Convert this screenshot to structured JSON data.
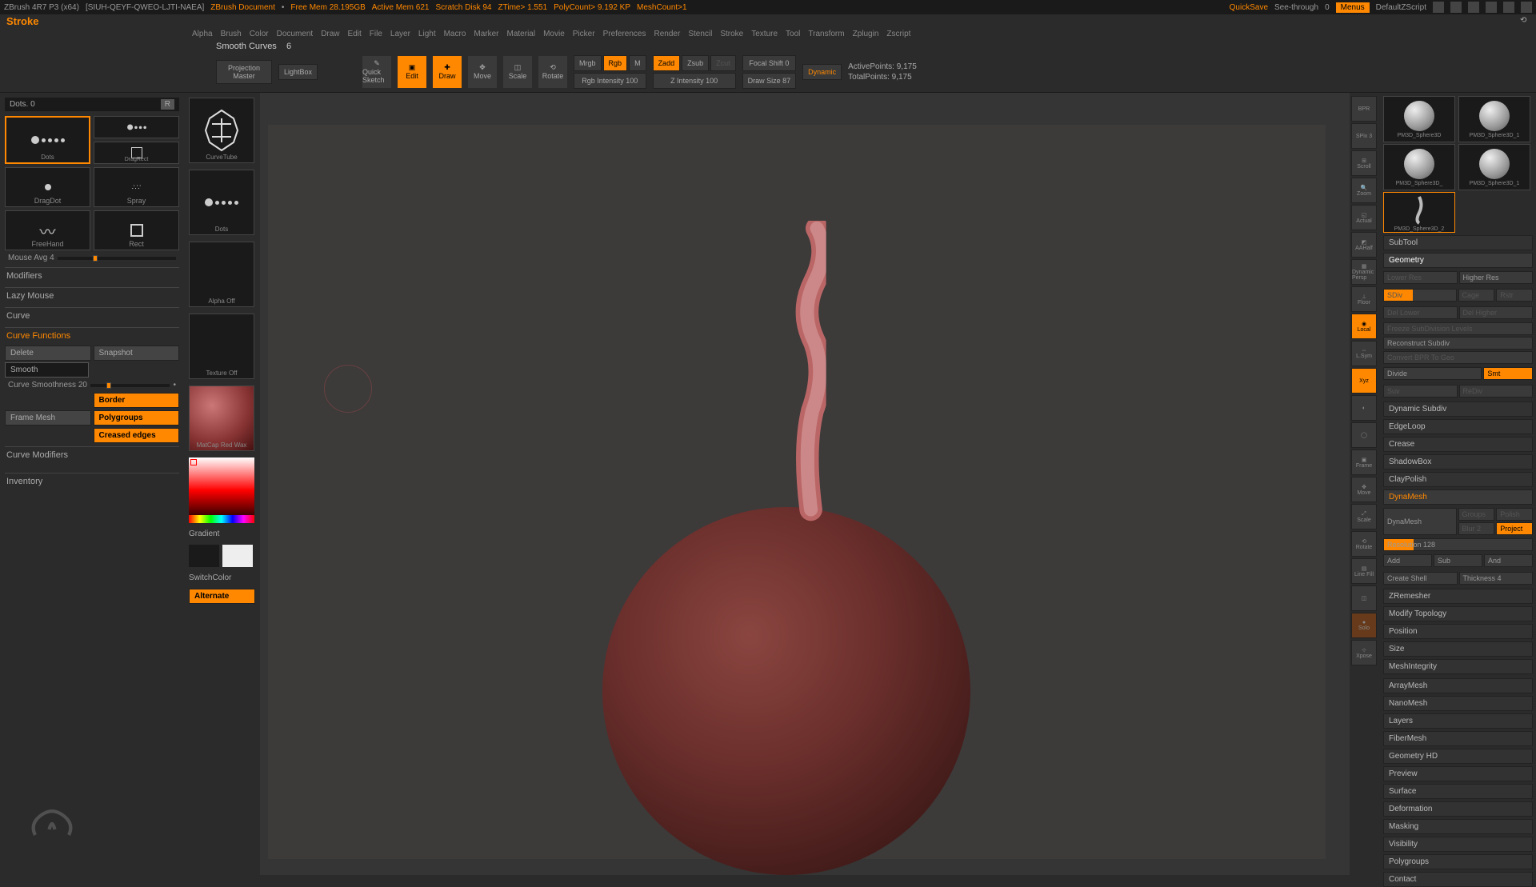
{
  "topbar": {
    "app": "ZBrush 4R7 P3 (x64)",
    "hash": "[SIUH-QEYF-QWEO-LJTI-NAEA]",
    "doc": "ZBrush Document",
    "freemem": "Free Mem 28.195GB",
    "activemem": "Active Mem 621",
    "scratch": "Scratch Disk 94",
    "ztime": "ZTime> 1.551",
    "polycount": "PolyCount> 9.192 KP",
    "meshcount": "MeshCount>1",
    "quicksave": "QuickSave",
    "seethrough": "See-through",
    "seethrough_val": "0",
    "menus": "Menus",
    "script": "DefaultZScript"
  },
  "palette_title": "Stroke",
  "menus": [
    "Alpha",
    "Brush",
    "Color",
    "Document",
    "Draw",
    "Edit",
    "File",
    "Layer",
    "Light",
    "Macro",
    "Marker",
    "Material",
    "Movie",
    "Picker",
    "Preferences",
    "Render",
    "Stencil",
    "Stroke",
    "Texture",
    "Tool",
    "Transform",
    "Zplugin",
    "Zscript"
  ],
  "status_line": {
    "text": "Smooth Curves",
    "val": "6"
  },
  "toolbar": {
    "proj_master": "Projection Master",
    "lightbox": "LightBox",
    "quick_sketch": "Quick Sketch",
    "edit": "Edit",
    "draw": "Draw",
    "move": "Move",
    "scale": "Scale",
    "rotate": "Rotate",
    "mrgb": "Mrgb",
    "rgb": "Rgb",
    "m": "M",
    "rgb_int": "Rgb Intensity 100",
    "zadd": "Zadd",
    "zsub": "Zsub",
    "zcut": "Zcut",
    "z_int": "Z Intensity 100",
    "focal": "Focal Shift 0",
    "draw_size": "Draw Size 87",
    "dynamic": "Dynamic",
    "active_pts": "ActivePoints: 9,175",
    "total_pts": "TotalPoints: 9,175"
  },
  "left": {
    "dots_label": "Dots. 0",
    "r": "R",
    "strokes": [
      "Dots",
      "Dots",
      "DragDot",
      "Spray",
      "FreeHand",
      "Rect",
      "DragRect"
    ],
    "mouse_avg": "Mouse Avg 4",
    "modifiers": "Modifiers",
    "lazy": "Lazy Mouse",
    "curve": "Curve",
    "curve_fn": "Curve Functions",
    "delete": "Delete",
    "snapshot": "Snapshot",
    "smooth": "Smooth",
    "curve_smooth": "Curve Smoothness 20",
    "border": "Border",
    "frame_mesh": "Frame Mesh",
    "polygroups": "Polygroups",
    "creased": "Creased edges",
    "curve_mod": "Curve Modifiers",
    "inventory": "Inventory"
  },
  "shelf": {
    "curve_tube": "CurveTube",
    "dots": "Dots",
    "alpha_off": "Alpha Off",
    "texture_off": "Texture Off",
    "matcap": "MatCap Red Wax",
    "gradient": "Gradient",
    "switch": "SwitchColor",
    "alternate": "Alternate"
  },
  "right_icons": [
    "BPR",
    "SPix 3",
    "Scroll",
    "Zoom",
    "Actual",
    "AAHalf",
    "Dynamic Persp",
    "Floor",
    "Local",
    "L.Sym",
    "Xyz",
    "",
    "",
    "Frame",
    "Move",
    "Scale",
    "Rotate",
    "Line Fill",
    "",
    "Solo",
    "Xpose"
  ],
  "rp": {
    "tools": [
      "PM3D_Sphere3D",
      "PM3D_Sphere3D_1",
      "PM3D_Sphere3D_",
      "PM3D_Sphere3D_1",
      "PM3D_Sphere3D_2"
    ],
    "subtool": "SubTool",
    "geometry": "Geometry",
    "lower": "Lower Res",
    "higher": "Higher Res",
    "sdiv": "SDiv",
    "cage": "Cage",
    "rstr": "Rstr",
    "del_lower": "Del Lower",
    "del_higher": "Del Higher",
    "freeze": "Freeze SubDivision Levels",
    "reconstruct": "Reconstruct Subdiv",
    "convert": "Convert BPR To Geo",
    "divide": "Divide",
    "smt": "Smt",
    "suv": "Suv",
    "rediv": "ReDiv",
    "dyn_subdiv": "Dynamic Subdiv",
    "edgeloop": "EdgeLoop",
    "crease": "Crease",
    "shadowbox": "ShadowBox",
    "claypolish": "ClayPolish",
    "dynamesh_hdr": "DynaMesh",
    "dynamesh": "DynaMesh",
    "groups": "Groups",
    "polish": "Polish",
    "blur": "Blur 2",
    "project": "Project",
    "resolution": "Resolution 128",
    "add": "Add",
    "sub": "Sub",
    "and": "And",
    "create_shell": "Create Shell",
    "thickness": "Thickness 4",
    "zremesher": "ZRemesher",
    "mod_topo": "Modify Topology",
    "position": "Position",
    "size": "Size",
    "mesh_int": "MeshIntegrity",
    "rest": [
      "ArrayMesh",
      "NanoMesh",
      "Layers",
      "FiberMesh",
      "Geometry HD",
      "Preview",
      "Surface",
      "Deformation",
      "Masking",
      "Visibility",
      "Polygroups",
      "Contact"
    ]
  }
}
